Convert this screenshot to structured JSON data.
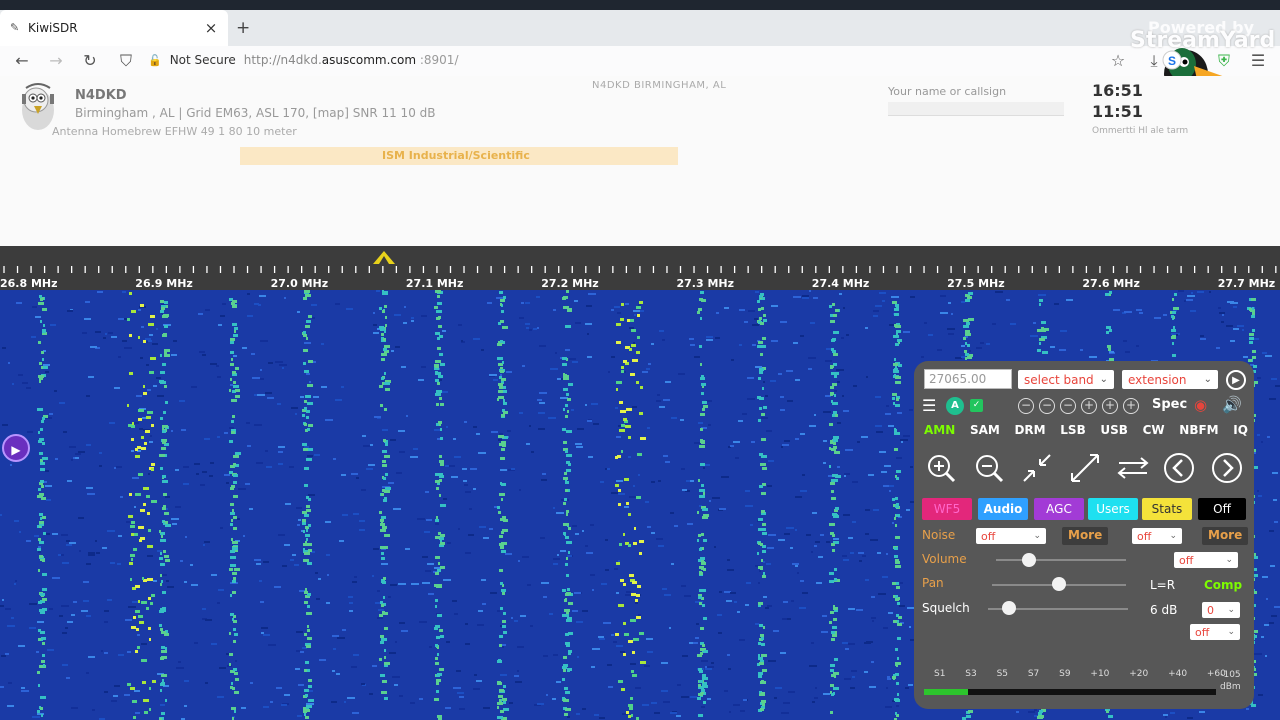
{
  "browser": {
    "tab_title": "KiwiSDR",
    "tab_close": "×",
    "new_tab": "+",
    "security_label": "Not Secure",
    "url_scheme": "http://n4dkd.",
    "url_domain": "asuscomm.com",
    "url_port": ":8901/"
  },
  "overlay": {
    "powered_by": "Powered by",
    "brand": "StreamYard"
  },
  "station": {
    "callsign": "N4DKD",
    "info_line": "Birmingham , AL | Grid EM63, ASL 170, [map]  SNR 11 10 dB",
    "antenna_line": "Antenna  Homebrew EFHW 49 1 80  10 meter",
    "location_title": "N4DKD BIRMINGHAM, AL",
    "name_prompt": "Your name or callsign",
    "utc_time": "16:51",
    "local_time": "11:51",
    "clock_sub": "Ommertti Hl ale tarm",
    "band_banner": "ISM Industrial/Scientific"
  },
  "scale": {
    "labels": [
      "26.8 MHz",
      "26.9 MHz",
      "27.0 MHz",
      "27.1 MHz",
      "27.2 MHz",
      "27.3 MHz",
      "27.4 MHz",
      "27.5 MHz",
      "27.6 MHz",
      "27.7 MHz"
    ]
  },
  "panel": {
    "frequency": "27065.00",
    "band_select": "select band",
    "extension_select": "extension",
    "spec_label": "Spec",
    "modes": [
      "AMN",
      "SAM",
      "DRM",
      "LSB",
      "USB",
      "CW",
      "NBFM",
      "IQ"
    ],
    "active_mode": "AMN",
    "tabs": [
      "WF5",
      "Audio",
      "AGC",
      "Users",
      "Stats",
      "Off"
    ],
    "noise_label": "Noise",
    "noise_value": "off",
    "more_label": "More",
    "filter_value": "off",
    "more2_label": "More",
    "volume_label": "Volume",
    "volume_value": "off",
    "pan_label": "Pan",
    "pan_value": "L=R",
    "comp_label": "Comp",
    "squelch_label": "Squelch",
    "squelch_db": "6 dB",
    "squelch_value": "0",
    "squelch_off": "off",
    "smeter_scale": [
      "S1",
      "S3",
      "S5",
      "S7",
      "S9",
      "+10",
      "+20",
      "+40",
      "+60"
    ],
    "smeter_top": "-105",
    "smeter_unit": "dBm",
    "volume_level": 0.25,
    "pan_level": 0.5,
    "squelch_level": 0.15,
    "signal_level": 0.15
  },
  "colors": {
    "accent_active_mode": "#7CFC00",
    "tab_wf": "#e3277b",
    "tab_audio": "#2fa0ff",
    "tab_agc": "#a23bd6",
    "tab_users": "#1ee0f0",
    "tab_stats": "#f4e23a",
    "tab_off": "#000000"
  }
}
